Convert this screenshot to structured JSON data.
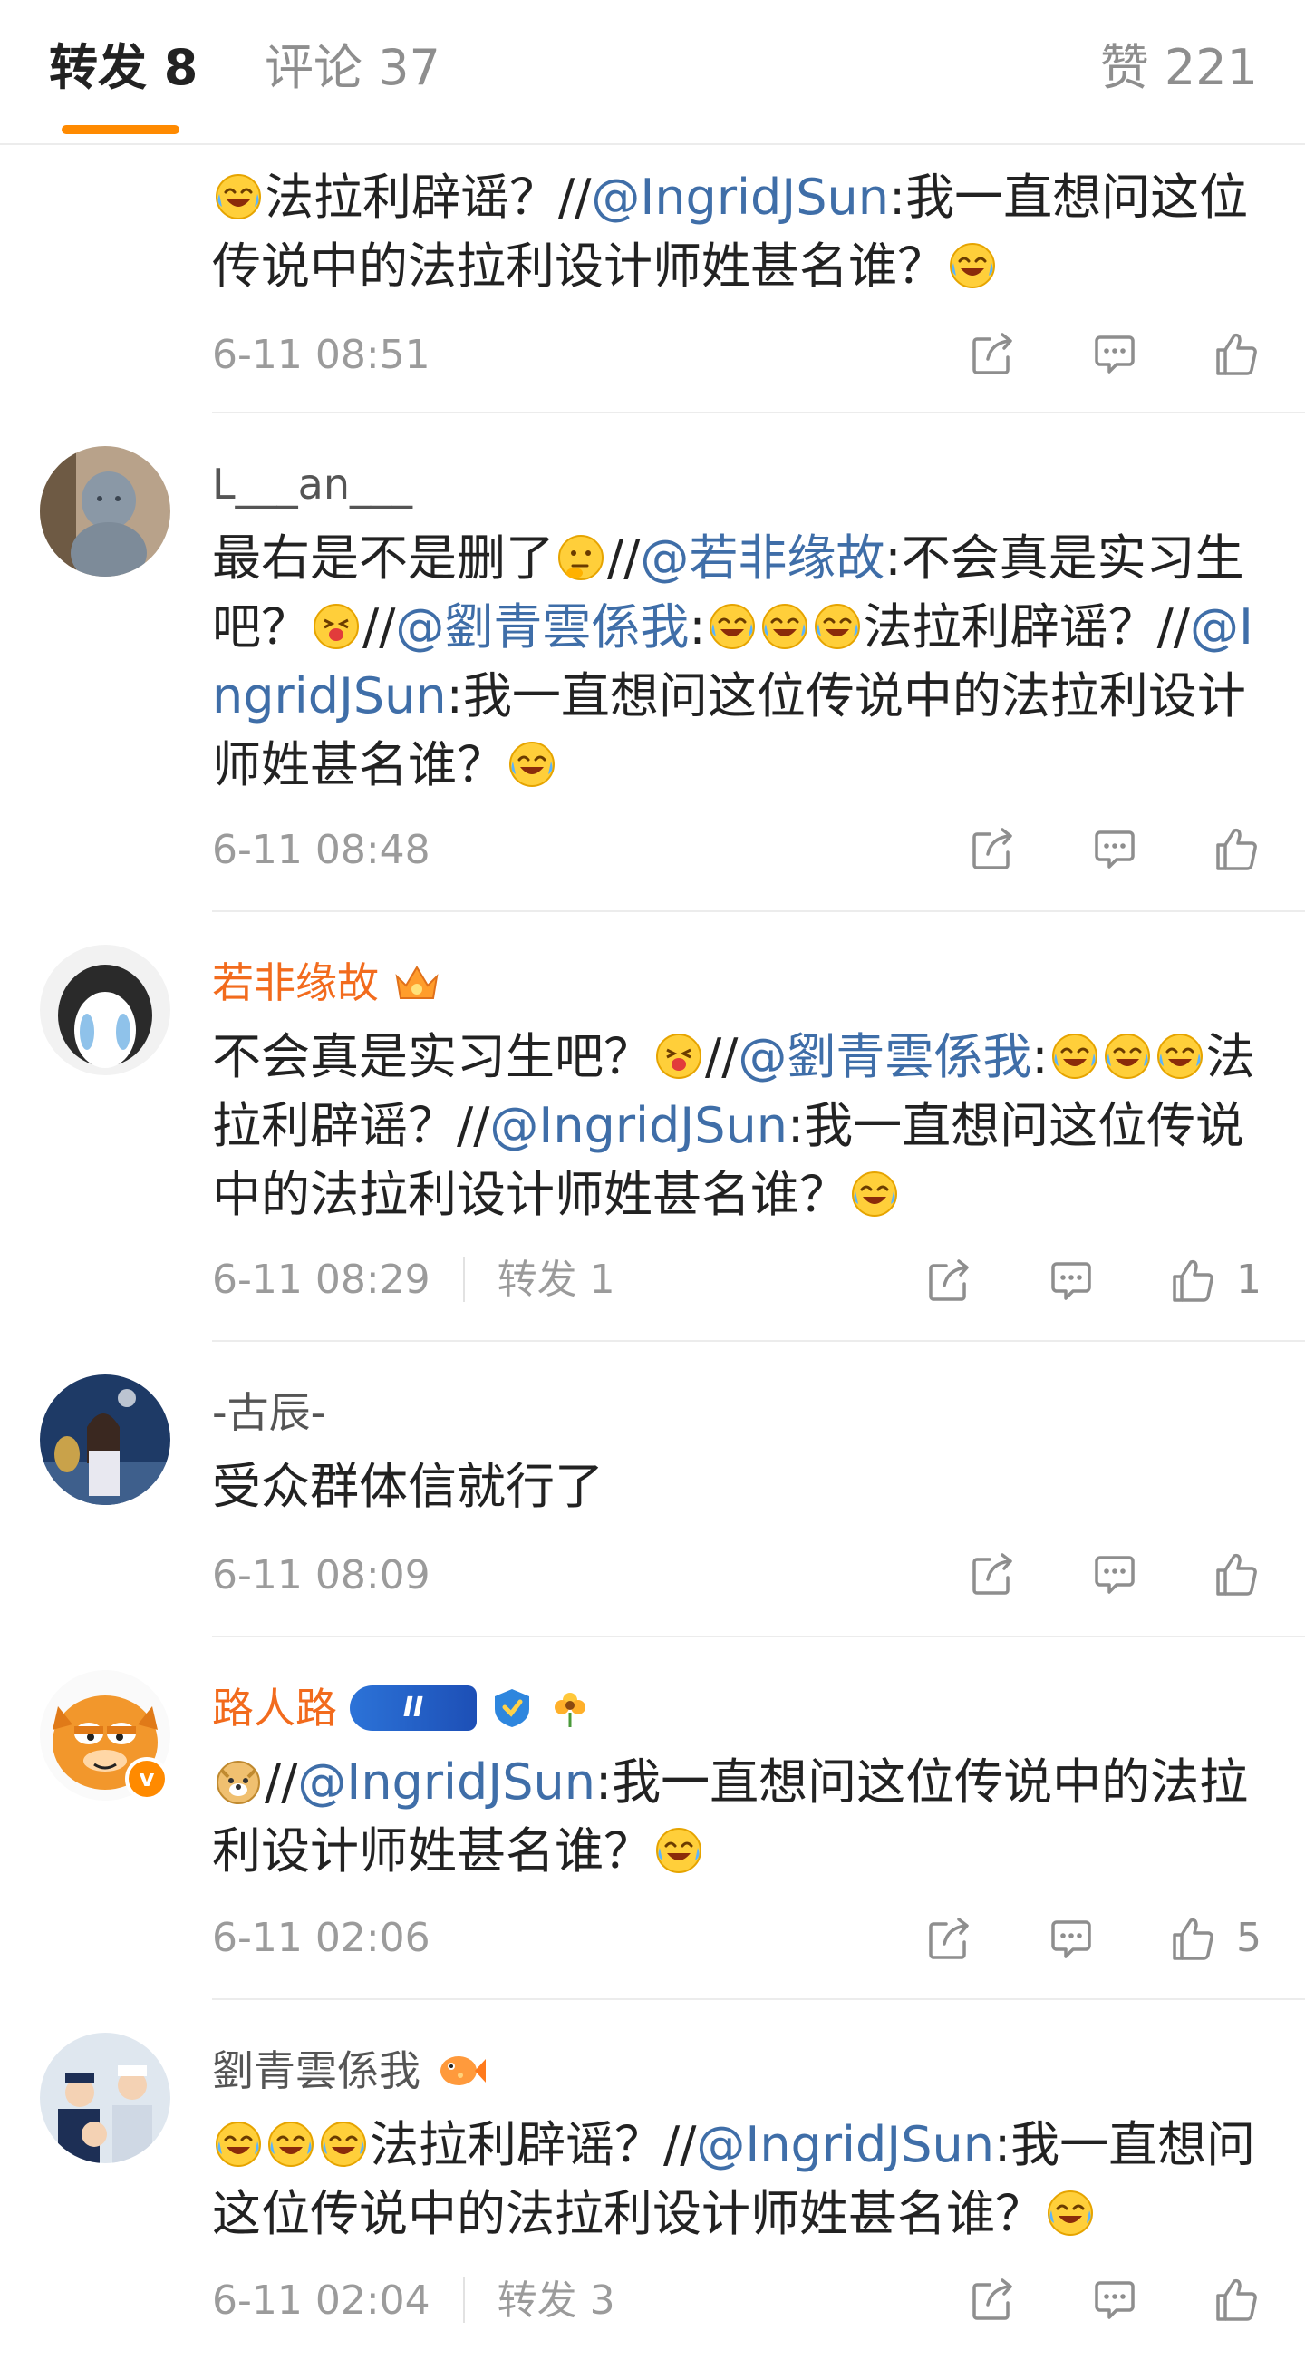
{
  "tabs": {
    "repost": "转发 8",
    "comment": "评论 37",
    "like": "赞 221"
  },
  "items": [
    {
      "text": "法拉利辟谣？//@IngridJSun:我一直想问这位传说中的法拉利设计师姓甚名谁？",
      "time": "6-11 08:51"
    },
    {
      "user": "L___an___",
      "text": "最右是不是删了//@若非缘故:不会真是实习生吧？//@劉青雲係我:法拉利辟谣？//@IngridJSun:我一直想问这位传说中的法拉利设计师姓甚名谁？",
      "time": "6-11 08:48"
    },
    {
      "user": "若非缘故",
      "text": "不会真是实习生吧？//@劉青雲係我:法拉利辟谣？//@IngridJSun:我一直想问这位传说中的法拉利设计师姓甚名谁？",
      "time": "6-11 08:29",
      "repost": "转发 1",
      "likes": "1"
    },
    {
      "user": "-古辰-",
      "text": "受众群体信就行了",
      "time": "6-11 08:09"
    },
    {
      "user": "路人路",
      "level": "II",
      "text": "//@IngridJSun:我一直想问这位传说中的法拉利设计师姓甚名谁？",
      "time": "6-11 02:06",
      "likes": "5"
    },
    {
      "user": "劉青雲係我",
      "text": "法拉利辟谣？//@IngridJSun:我一直想问这位传说中的法拉利设计师姓甚名谁？",
      "time": "6-11 02:04",
      "repost": "转发 3"
    }
  ],
  "frag": {
    "i0_a": "法拉利辟谣？//",
    "i0_m": "@IngridJSun",
    "i0_b": ":我一直想问这位传说中的法拉利设计师姓甚名谁？",
    "i1_a": "最右是不是删了",
    "i1_s1": "//",
    "i1_m1": "@若非缘故",
    "i1_b": ":不会真是实习生吧？",
    "i1_s2": "//",
    "i1_m2": "@劉青雲係我",
    "i1_c": ":",
    "i1_d": "法拉利辟谣？//",
    "i1_m3": "@IngridJSun",
    "i1_e": ":我一直想问这位传说中的法拉利设计师姓甚名谁？",
    "i2_a": "不会真是实习生吧？",
    "i2_s": "//",
    "i2_m1": "@劉青雲係我",
    "i2_c": ":",
    "i2_d": "法拉利辟谣？//",
    "i2_m2": "@IngridJSun",
    "i2_e": ":我一直想问这位传说中的法拉利设计师姓甚名谁？",
    "i3_a": "受众群体信就行了",
    "i4_s": "//",
    "i4_m": "@IngridJSun",
    "i4_e": ":我一直想问这位传说中的法拉利设计师姓甚名谁？",
    "i5_d": "法拉利辟谣？//",
    "i5_m": "@IngridJSun",
    "i5_e": ":我一直想问这位传说中的法拉利设计师姓甚名谁？"
  },
  "colors": {
    "accent": "#ff8a00",
    "mention": "#3f6ea8",
    "vip_name": "#f26b1d",
    "muted": "#9b9b9b"
  },
  "icons": [
    "share-icon",
    "comment-icon",
    "like-icon",
    "laugh-cry-emoji",
    "thinking-emoji",
    "tongue-emoji",
    "crown-icon",
    "verified-badge"
  ]
}
